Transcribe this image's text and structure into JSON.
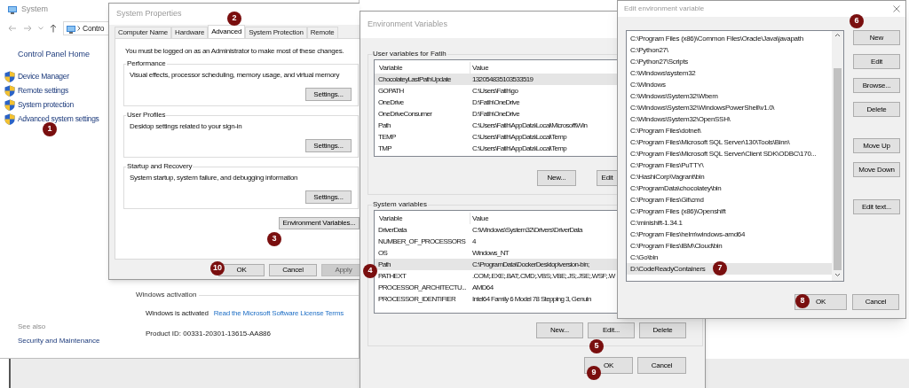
{
  "system_window": {
    "title": "System",
    "address": "Contro",
    "home_link": "Control Panel Home",
    "tasks": [
      "Device Manager",
      "Remote settings",
      "System protection",
      "Advanced system settings"
    ],
    "activation": {
      "heading": "Windows activation",
      "status": "Windows is activated",
      "link": "Read the Microsoft Software License Terms",
      "product_id": "Product ID: 00331-20301-13615-AA886"
    },
    "see_also": {
      "heading": "See also",
      "links": [
        "Security and Maintenance"
      ]
    }
  },
  "system_properties": {
    "title": "System Properties",
    "tabs": [
      {
        "label": "Computer Name",
        "selected": false
      },
      {
        "label": "Hardware",
        "selected": false
      },
      {
        "label": "Advanced",
        "selected": true
      },
      {
        "label": "System Protection",
        "selected": false
      },
      {
        "label": "Remote",
        "selected": false
      }
    ],
    "notice": "You must be logged on as an Administrator to make most of these changes.",
    "groups": [
      {
        "title": "Performance",
        "description": "Visual effects, processor scheduling, memory usage, and virtual memory",
        "button": "Settings..."
      },
      {
        "title": "User Profiles",
        "description": "Desktop settings related to your sign-in",
        "button": "Settings..."
      },
      {
        "title": "Startup and Recovery",
        "description": "System startup, system failure, and debugging information",
        "button": "Settings..."
      }
    ],
    "env_button": "Environment Variables...",
    "buttons": [
      {
        "label": "OK",
        "disabled": false
      },
      {
        "label": "Cancel",
        "disabled": false
      },
      {
        "label": "Apply",
        "disabled": true
      }
    ]
  },
  "environment_variables": {
    "title": "Environment Variables",
    "user_variables": {
      "title": "User variables for Fatih",
      "columns": [
        "Variable",
        "Value"
      ],
      "rows": [
        {
          "variable": "ChocolateyLastPathUpdate",
          "value": "132054835103533519",
          "selected": true
        },
        {
          "variable": "GOPATH",
          "value": "C:\\Users\\Fatih\\go",
          "selected": false
        },
        {
          "variable": "OneDrive",
          "value": "D:\\Fatih\\OneDrive",
          "selected": false
        },
        {
          "variable": "OneDriveConsumer",
          "value": "D:\\Fatih\\OneDrive",
          "selected": false
        },
        {
          "variable": "Path",
          "value": "C:\\Users\\Fatih\\AppData\\Local\\Microsoft\\Win",
          "selected": false
        },
        {
          "variable": "TEMP",
          "value": "C:\\Users\\Fatih\\AppData\\Local\\Temp",
          "selected": false
        },
        {
          "variable": "TMP",
          "value": "C:\\Users\\Fatih\\AppData\\Local\\Temp",
          "selected": false
        }
      ],
      "buttons": [
        "New...",
        "Edit"
      ]
    },
    "system_variables": {
      "title": "System variables",
      "columns": [
        "Variable",
        "Value"
      ],
      "rows": [
        {
          "variable": "DriverData",
          "value": "C:\\Windows\\System32\\Drivers\\DriverData",
          "selected": false
        },
        {
          "variable": "NUMBER_OF_PROCESSORS",
          "value": "4",
          "selected": false
        },
        {
          "variable": "OS",
          "value": "Windows_NT",
          "selected": false
        },
        {
          "variable": "Path",
          "value": "C:\\ProgramData\\DockerDesktop\\version-bin;",
          "selected": true
        },
        {
          "variable": "PATHEXT",
          "value": ".COM;.EXE;.BAT;.CMD;.VBS;.VBE;.JS;.JSE;.WSF;.W",
          "selected": false
        },
        {
          "variable": "PROCESSOR_ARCHITECTU...",
          "value": "AMD64",
          "selected": false
        },
        {
          "variable": "PROCESSOR_IDENTIFIER",
          "value": "Intel64 Family 6 Model 78 Stepping 3, Genuin",
          "selected": false
        }
      ],
      "buttons": [
        "New...",
        "Edit...",
        "Delete"
      ]
    },
    "buttons": [
      "OK",
      "Cancel"
    ]
  },
  "edit_variable": {
    "title": "Edit environment variable",
    "entries": [
      {
        "text": "C:\\Program Files (x86)\\Common Files\\Oracle\\Java\\javapath",
        "selected": false
      },
      {
        "text": "C:\\Python27\\",
        "selected": false
      },
      {
        "text": "C:\\Python27\\Scripts",
        "selected": false
      },
      {
        "text": "C:\\Windows\\system32",
        "selected": false
      },
      {
        "text": "C:\\Windows",
        "selected": false
      },
      {
        "text": "C:\\Windows\\System32\\Wbem",
        "selected": false
      },
      {
        "text": "C:\\Windows\\System32\\WindowsPowerShell\\v1.0\\",
        "selected": false
      },
      {
        "text": "C:\\Windows\\System32\\OpenSSH\\",
        "selected": false
      },
      {
        "text": "C:\\Program Files\\dotnet\\",
        "selected": false
      },
      {
        "text": "C:\\Program Files\\Microsoft SQL Server\\130\\Tools\\Binn\\",
        "selected": false
      },
      {
        "text": "C:\\Program Files\\Microsoft SQL Server\\Client SDK\\ODBC\\170...",
        "selected": false
      },
      {
        "text": "C:\\Program Files\\PuTTY\\",
        "selected": false
      },
      {
        "text": "C:\\HashiCorp\\Vagrant\\bin",
        "selected": false
      },
      {
        "text": "C:\\ProgramData\\chocolatey\\bin",
        "selected": false
      },
      {
        "text": "C:\\Program Files\\Git\\cmd",
        "selected": false
      },
      {
        "text": "C:\\Program Files (x86)\\Openshift",
        "selected": false
      },
      {
        "text": "C:\\minishift-1.34.1",
        "selected": false
      },
      {
        "text": "C:\\Program Files\\helm\\windows-amd64",
        "selected": false
      },
      {
        "text": "C:\\Program Files\\IBM\\Cloud\\bin",
        "selected": false
      },
      {
        "text": "C:\\Go\\bin",
        "selected": false
      },
      {
        "text": "D:\\CodeReadyContainers",
        "selected": true
      }
    ],
    "side_buttons": [
      "New",
      "Edit",
      "Browse...",
      "Delete",
      "Move Up",
      "Move Down",
      "Edit text..."
    ],
    "buttons": [
      "OK",
      "Cancel"
    ]
  },
  "callouts": [
    "1",
    "2",
    "3",
    "4",
    "5",
    "6",
    "7",
    "8",
    "9",
    "10"
  ]
}
